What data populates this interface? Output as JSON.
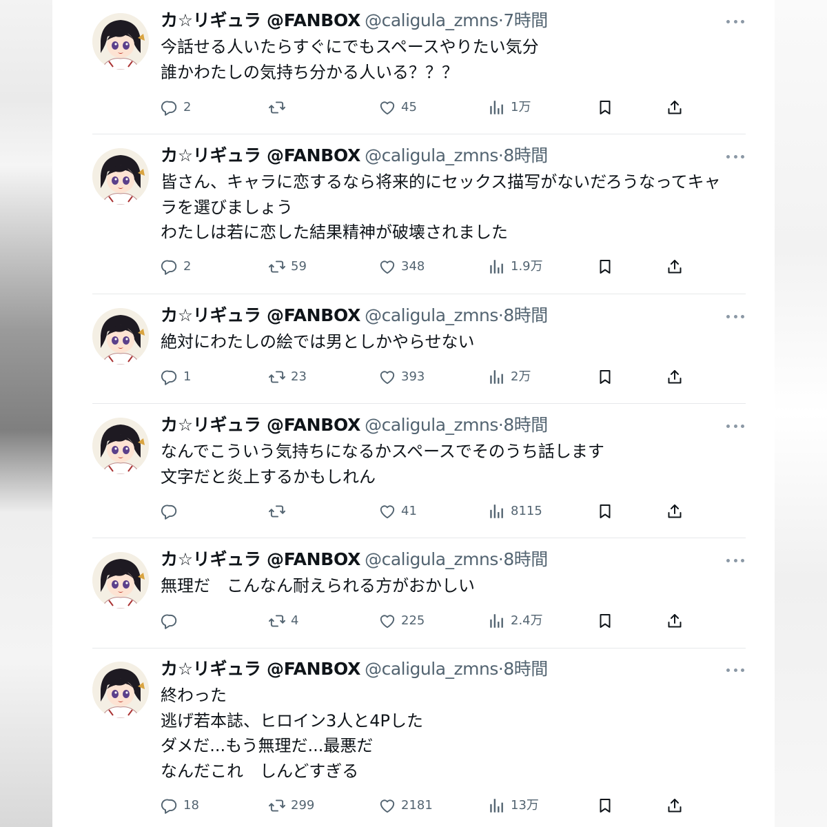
{
  "author": {
    "name": "カ☆リギュラ @FANBOX",
    "handle": "@caligula_zmns"
  },
  "tweets": [
    {
      "time": "·7時間",
      "lines": [
        "今話せる人いたらすぐにでもスペースやりたい気分",
        "誰かわたしの気持ち分かる人いる？？？"
      ],
      "reply": "2",
      "retweet": "",
      "like": "45",
      "views": "1万"
    },
    {
      "time": "·8時間",
      "lines": [
        "皆さん、キャラに恋するなら将来的にセックス描写がないだろうなってキャ",
        "ラを選びましょう",
        "わたしは若に恋した結果精神が破壊されました"
      ],
      "reply": "2",
      "retweet": "59",
      "like": "348",
      "views": "1.9万"
    },
    {
      "time": "·8時間",
      "lines": [
        "絶対にわたしの絵では男としかやらせない"
      ],
      "reply": "1",
      "retweet": "23",
      "like": "393",
      "views": "2万"
    },
    {
      "time": "·8時間",
      "lines": [
        "なんでこういう気持ちになるかスペースでそのうち話します",
        "文字だと炎上するかもしれん"
      ],
      "reply": "",
      "retweet": "",
      "like": "41",
      "views": "8115"
    },
    {
      "time": "·8時間",
      "lines": [
        "無理だ　こんなん耐えられる方がおかしい"
      ],
      "reply": "",
      "retweet": "4",
      "like": "225",
      "views": "2.4万"
    },
    {
      "time": "·8時間",
      "lines": [
        "終わった",
        "逃げ若本誌、ヒロイン3人と4Pした",
        "ダメだ...もう無理だ...最悪だ",
        "なんだこれ　しんどすぎる"
      ],
      "reply": "18",
      "retweet": "299",
      "like": "2181",
      "views": "13万"
    }
  ],
  "icons": {
    "reply": "speech-bubble-icon",
    "retweet": "retweet-arrows-icon",
    "like": "heart-outline-icon",
    "views": "bar-chart-icon",
    "bookmark": "bookmark-icon",
    "share": "share-upload-icon",
    "more": "three-dots-icon"
  },
  "colors": {
    "text_primary": "#0f1419",
    "text_secondary": "#536471",
    "divider": "#e6e8ea"
  }
}
